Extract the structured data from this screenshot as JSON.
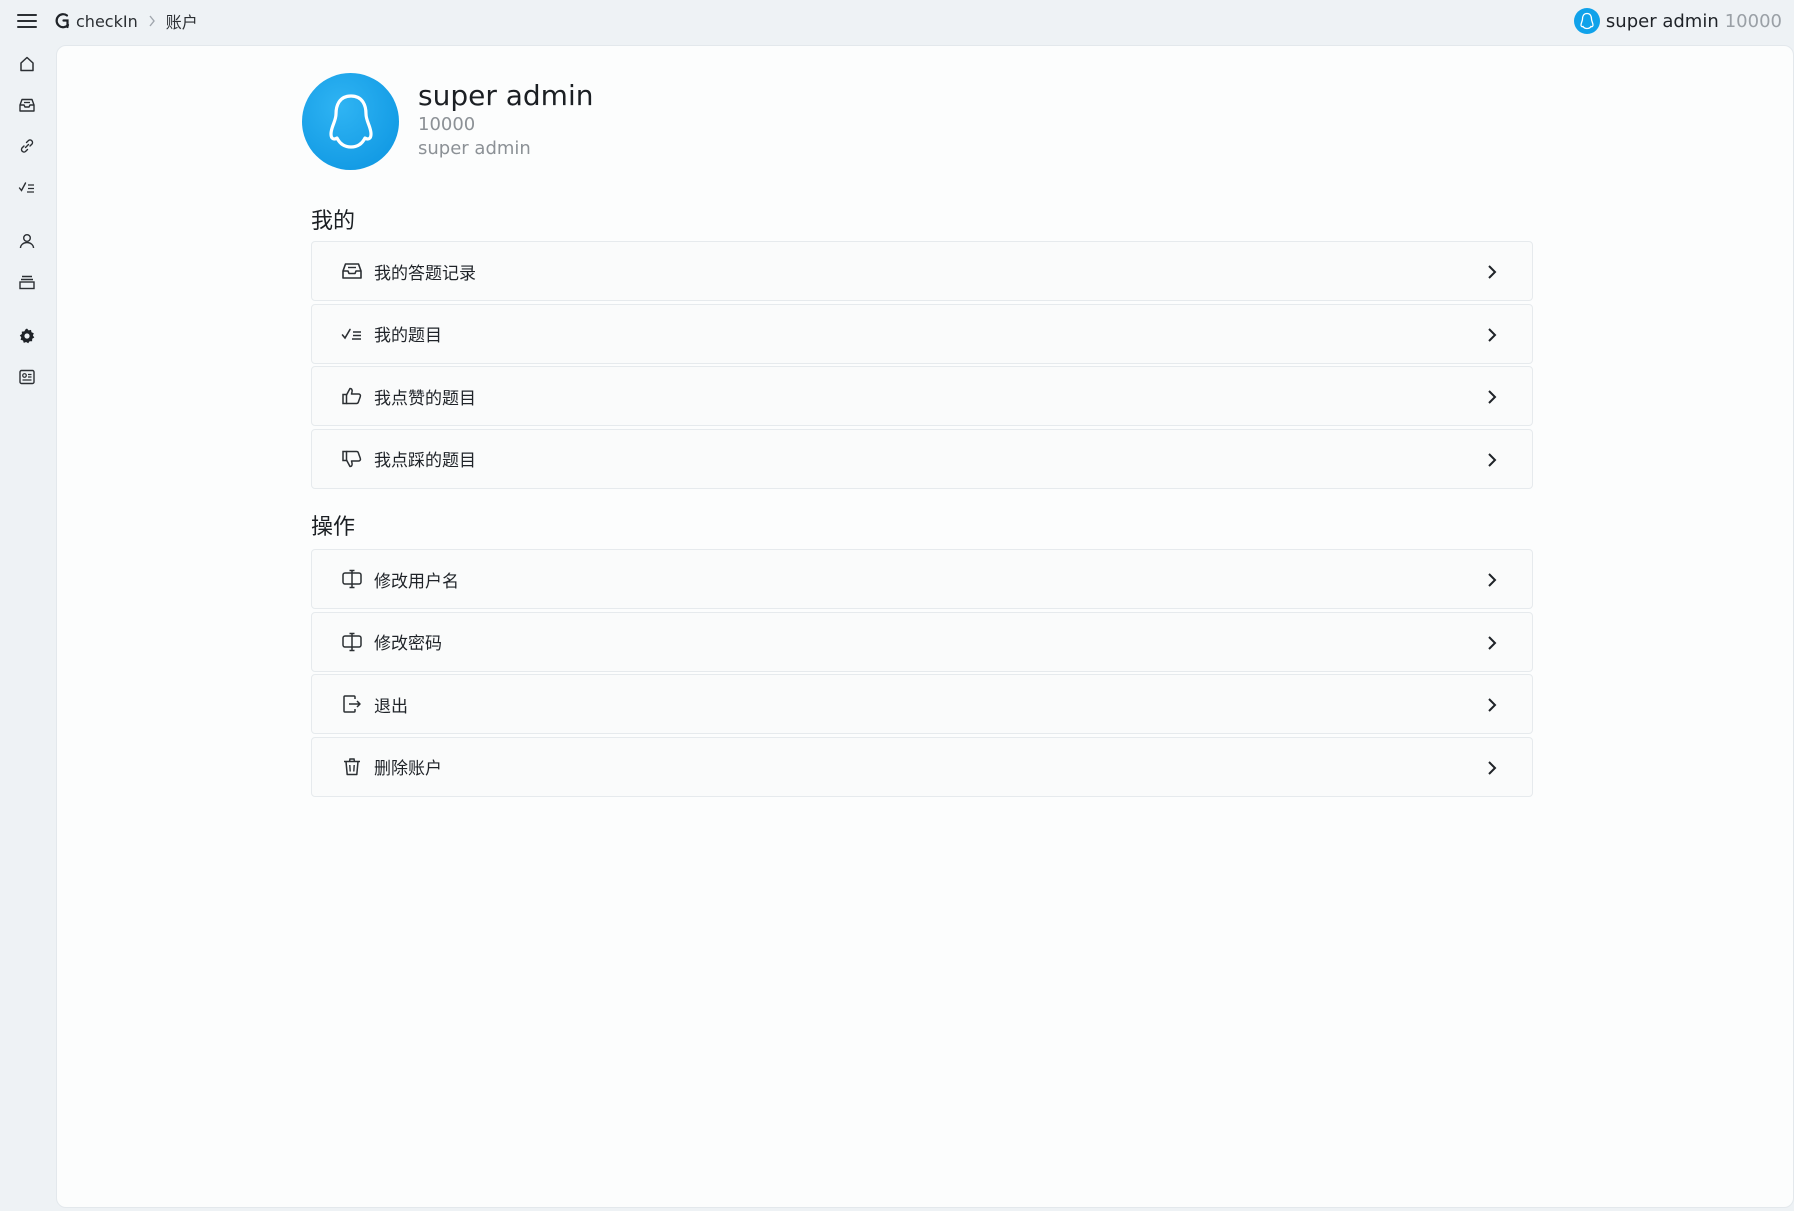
{
  "topbar": {
    "breadcrumb": {
      "app": "checkIn",
      "current": "账户"
    },
    "user": {
      "name": "super admin",
      "id": "10000"
    }
  },
  "sidebar": {
    "icons": [
      "home-icon",
      "inbox-icon",
      "link-icon",
      "checklist-icon",
      "user-icon",
      "archive-icon",
      "gear-icon",
      "id-card-icon"
    ]
  },
  "profile": {
    "name": "super admin",
    "id": "10000",
    "subtitle": "super admin"
  },
  "sections": {
    "mine": {
      "title": "我的",
      "items": [
        {
          "label": "我的答题记录",
          "icon": "inbox-icon"
        },
        {
          "label": "我的题目",
          "icon": "checklist-icon"
        },
        {
          "label": "我点赞的题目",
          "icon": "thumbs-up-icon"
        },
        {
          "label": "我点踩的题目",
          "icon": "thumbs-down-icon"
        }
      ]
    },
    "actions": {
      "title": "操作",
      "items": [
        {
          "label": "修改用户名",
          "icon": "edit-icon"
        },
        {
          "label": "修改密码",
          "icon": "edit-icon"
        },
        {
          "label": "退出",
          "icon": "logout-icon"
        },
        {
          "label": "删除账户",
          "icon": "trash-icon"
        }
      ]
    }
  },
  "colors": {
    "accent": "#10a2ea",
    "background": "#eef2f5",
    "card": "#fcfdfd"
  }
}
